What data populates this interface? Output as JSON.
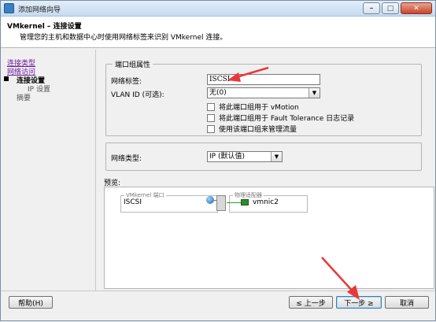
{
  "window": {
    "title": "添加网络向导"
  },
  "header": {
    "title": "VMkernel – 连接设置",
    "description": "管理您的主机和数据中心时使用网络标签来识别 VMkernel 连接。"
  },
  "nav": {
    "items": [
      {
        "label": "连接类型",
        "state": "visited"
      },
      {
        "label": "网络访问",
        "state": "visited"
      },
      {
        "label": "连接设置",
        "state": "current"
      },
      {
        "label": "IP 设置",
        "state": "sub"
      },
      {
        "label": "摘要",
        "state": "upcoming"
      }
    ]
  },
  "port_group": {
    "legend": "端口组属性",
    "network_label_caption": "网络标签:",
    "network_label_value": "ISCSI",
    "vlan_caption": "VLAN ID (可选):",
    "vlan_value": "无(0)",
    "checkboxes": [
      {
        "label": "将此端口组用于 vMotion",
        "checked": false
      },
      {
        "label": "将此端口组用于 Fault Tolerance 日志记录",
        "checked": false
      },
      {
        "label": "使用该端口组来管理流量",
        "checked": false
      }
    ]
  },
  "network_type": {
    "caption": "网络类型:",
    "value": "IP (默认值)"
  },
  "preview": {
    "caption": "预览:",
    "vmkernel_legend": "VMkernel 端口",
    "vmkernel_name": "ISCSI",
    "adapter_legend": "物理适配器",
    "adapter_name": "vmnic2"
  },
  "footer": {
    "help": "帮助(H)",
    "back": "≤ 上一步",
    "next": "下一步 ≥",
    "cancel": "取消"
  },
  "colors": {
    "annotation_arrow": "#e8383d",
    "link": "#6a1b9a"
  }
}
